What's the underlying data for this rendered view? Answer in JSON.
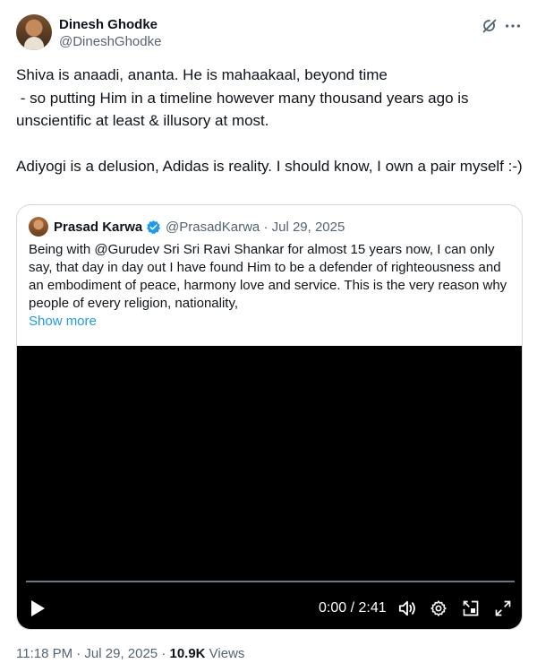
{
  "author": {
    "name": "Dinesh Ghodke",
    "handle": "@DineshGhodke"
  },
  "tweet": {
    "text": "Shiva is anaadi, ananta. He is mahaakaal, beyond time\n - so putting Him in a timeline however many thousand years ago is unscientific at least & illusory at most.\n\nAdiyogi is a delusion, Adidas is reality. I should know, I own a pair myself :-)"
  },
  "quote": {
    "name": "Prasad Karwa",
    "meta": "@PrasadKarwa · Jul 29, 2025",
    "text": "Being with @Gurudev Sri Sri Ravi Shankar for almost 15 years now, I can only say, that day in day out I have found Him to be a defender of righteousness and an embodiment of peace, harmony love and service. This is the very reason why people of every religion, nationality,",
    "show_more": "Show more",
    "video": {
      "time": "0:00 / 2:41",
      "progress": 0
    }
  },
  "footer": {
    "timestamp": "11:18 PM · Jul 29, 2025 · ",
    "views_count": "10.9K",
    "views_label": " Views"
  },
  "icons": {
    "grok": "grok-icon",
    "more": "more-icon",
    "verified": "verified-badge-icon",
    "play": "play-icon",
    "volume": "volume-icon",
    "settings": "gear-icon",
    "pip": "pip-icon",
    "fullscreen": "fullscreen-icon"
  },
  "colors": {
    "accent": "#1d9bf0",
    "text": "#0f1419",
    "secondary": "#536471",
    "border": "#cfd9de"
  }
}
